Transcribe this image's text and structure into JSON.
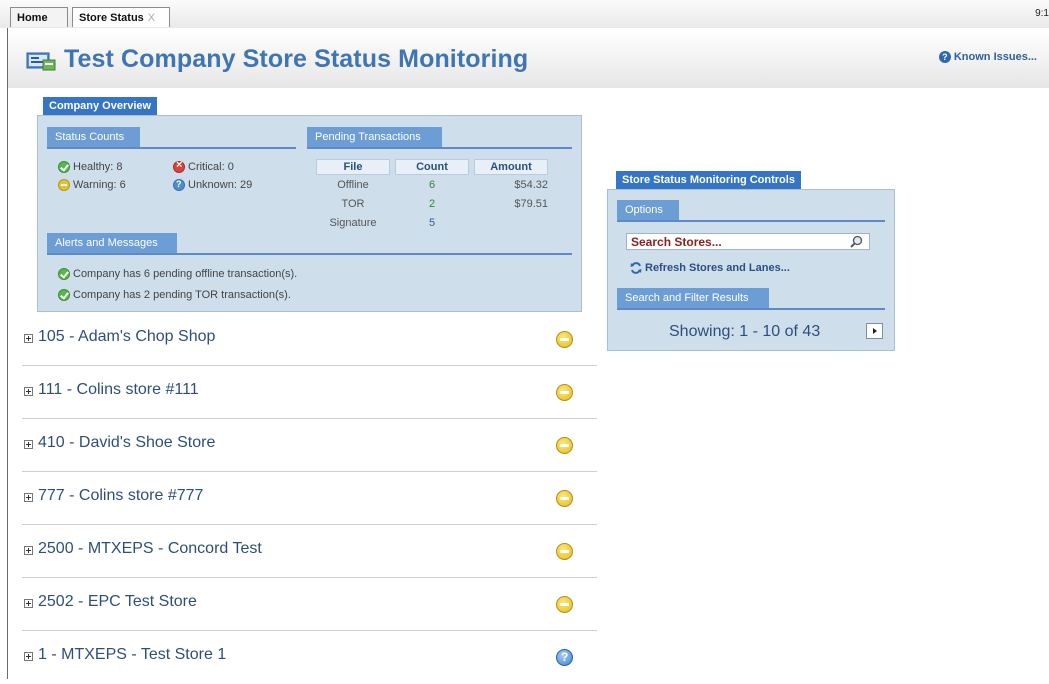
{
  "tabs": [
    {
      "label": "Home"
    },
    {
      "label": "Store Status",
      "close": "X"
    }
  ],
  "clock": "9:1",
  "header": {
    "title": "Test Company Store Status Monitoring",
    "known_issues": "Known Issues..."
  },
  "overview": {
    "tab_label": "Company Overview",
    "status_counts": {
      "title": "Status Counts",
      "healthy": "Healthy: 8",
      "warning": "Warning: 6",
      "critical": "Critical: 0",
      "unknown": "Unknown: 29"
    },
    "pending": {
      "title": "Pending Transactions",
      "headers": [
        "File",
        "Count",
        "Amount"
      ],
      "rows": [
        {
          "file": "Offline",
          "count": "6",
          "amount": "$54.32"
        },
        {
          "file": "TOR",
          "count": "2",
          "amount": "$79.51"
        },
        {
          "file": "Signature",
          "count": "5",
          "amount": ""
        }
      ]
    },
    "alerts": {
      "title": "Alerts and Messages",
      "items": [
        "Company has 6 pending offline transaction(s).",
        "Company has 2 pending TOR transaction(s)."
      ]
    }
  },
  "stores": [
    {
      "label": "105 - Adam's Chop Shop",
      "status": "warning"
    },
    {
      "label": "111 - Colins store #111",
      "status": "warning"
    },
    {
      "label": "410 - David's Shoe Store",
      "status": "warning"
    },
    {
      "label": "777 - Colins store #777",
      "status": "warning"
    },
    {
      "label": "2500 - MTXEPS - Concord Test",
      "status": "warning"
    },
    {
      "label": "2502 - EPC Test Store",
      "status": "warning"
    },
    {
      "label": "1 - MTXEPS - Test Store 1",
      "status": "unknown"
    }
  ],
  "controls": {
    "tab_label": "Store Status Monitoring Controls",
    "options_title": "Options",
    "search_placeholder": "Search Stores...",
    "refresh_label": "Refresh Stores and Lanes...",
    "results_title": "Search and Filter Results",
    "showing": "Showing: 1 - 10 of 43"
  },
  "colors": {
    "accent": "#3674c6",
    "panel_bg": "#cfdeeb",
    "title": "#3f75b2"
  }
}
